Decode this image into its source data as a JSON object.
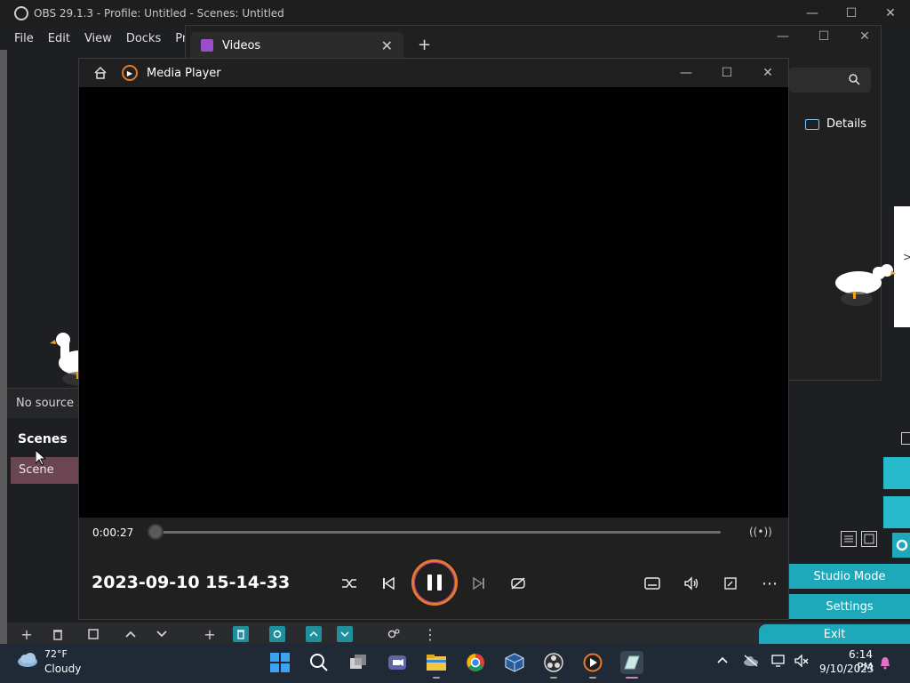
{
  "obs": {
    "title": "OBS 29.1.3 - Profile: Untitled - Scenes: Untitled",
    "menu": [
      "File",
      "Edit",
      "View",
      "Docks",
      "Pro"
    ],
    "no_source": "No source s",
    "scenes_title": "Scenes",
    "scene_item": "Scene",
    "controls": {
      "studio_mode": "Studio Mode",
      "settings": "Settings",
      "exit": "Exit"
    }
  },
  "videos_window": {
    "tab_label": "Videos",
    "details_label": "Details"
  },
  "edge_window": {
    "text": ">"
  },
  "media_player": {
    "app_name": "Media Player",
    "elapsed": "0:00:27",
    "progress_fraction": 0.0,
    "video_title": "2023-09-10 15-14-33"
  },
  "taskbar": {
    "weather_temp": "72°F",
    "weather_desc": "Cloudy",
    "time": "6:14 PM",
    "date": "9/10/2023"
  },
  "colors": {
    "obs_teal": "#1ea9ba",
    "scene_selected": "#6b4652",
    "play_ring": "#e67a2e",
    "taskbar": "#202a36"
  }
}
